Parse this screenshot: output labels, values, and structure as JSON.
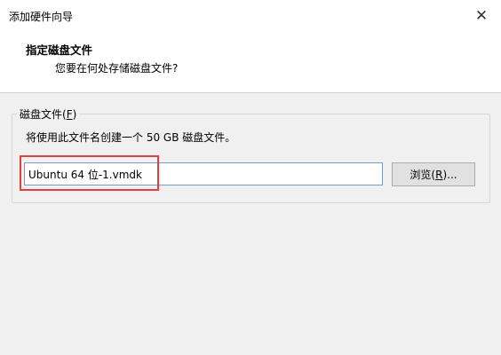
{
  "window": {
    "title": "添加硬件向导",
    "close_glyph": "✕"
  },
  "header": {
    "title": "指定磁盘文件",
    "subtitle": "您要在何处存储磁盘文件?"
  },
  "group": {
    "label_pre": "磁盘文件(",
    "label_key": "F",
    "label_post": ")",
    "description": "将使用此文件名创建一个 50 GB 磁盘文件。"
  },
  "file_field": {
    "value": "Ubuntu 64 位-1.vmdk"
  },
  "browse_button": {
    "label_pre": "浏览(",
    "label_key": "R",
    "label_post": ")..."
  },
  "annotation": {
    "highlight_color": "#e04040"
  }
}
